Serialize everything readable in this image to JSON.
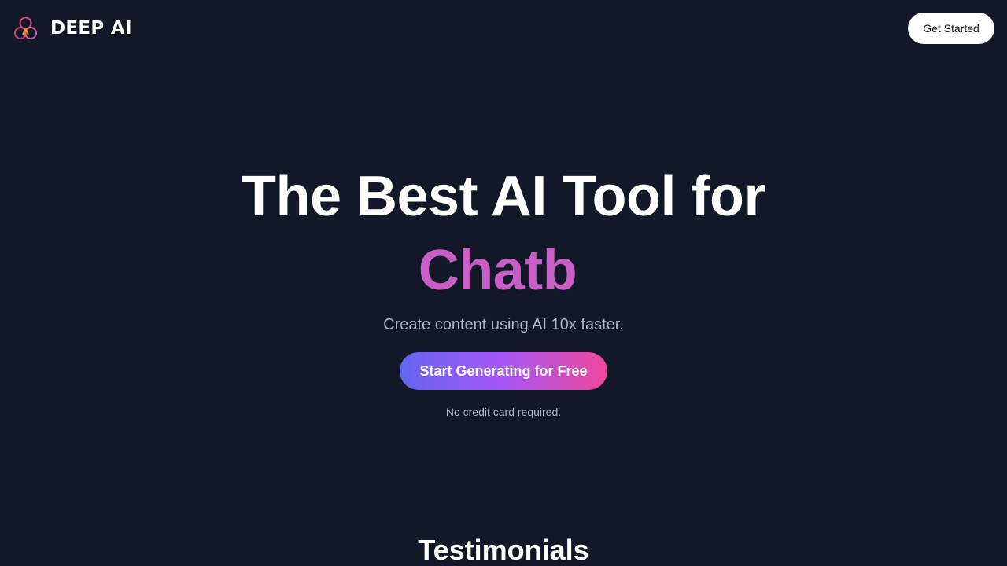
{
  "header": {
    "brand_name": "DEEP AI",
    "logo_icon": "interlocking-rings-logo-icon",
    "get_started_label": "Get Started"
  },
  "hero": {
    "headline_line1": "The Best AI Tool for",
    "headline_line2": "Chatb",
    "subtitle": "Create content using AI 10x faster.",
    "cta_label": "Start Generating for Free",
    "note": "No credit card required."
  },
  "sections": {
    "testimonials_title": "Testimonials"
  },
  "colors": {
    "background": "#121827",
    "accent_text": "#c85ec6",
    "cta_gradient_start": "#6366f1",
    "cta_gradient_mid": "#a855f7",
    "cta_gradient_end": "#ec4899",
    "muted_text": "#aeb3bf"
  }
}
